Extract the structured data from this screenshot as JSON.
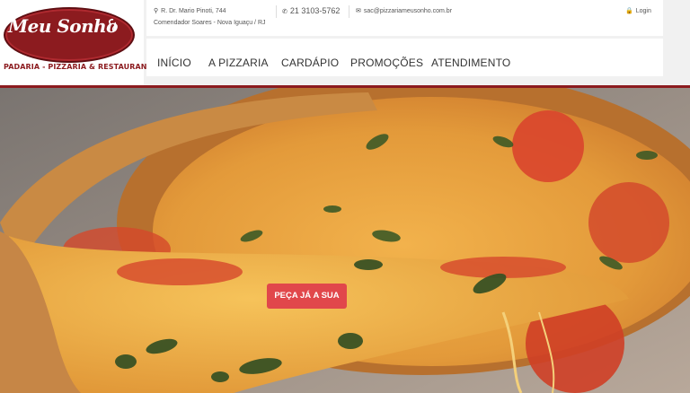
{
  "brand": {
    "logo_text": "Meu Sonho",
    "tagline": "PADARIA - PIZZARIA & RESTAURANTE"
  },
  "contact": {
    "address_line1": "R. Dr. Mario Pinoti, 744",
    "address_line2": "Comendador Soares - Nova Iguaçu / RJ",
    "phone": "21 3103-5762",
    "email": "sac@pizzariameusonho.com.br",
    "login_label": "Login"
  },
  "nav": {
    "items": [
      {
        "label": "INÍCIO"
      },
      {
        "label": "A PIZZARIA"
      },
      {
        "label": "CARDÁPIO"
      },
      {
        "label": "PROMOÇÕES"
      },
      {
        "label": "ATENDIMENTO"
      }
    ]
  },
  "hero": {
    "cta_label": "PEÇA JÁ A SUA"
  },
  "colors": {
    "brand": "#8c1b1f",
    "cta": "#e1474b",
    "header_bg": "#f1f1f1"
  },
  "icons": [
    "map-marker-icon",
    "phone-icon",
    "envelope-icon",
    "lock-icon"
  ]
}
